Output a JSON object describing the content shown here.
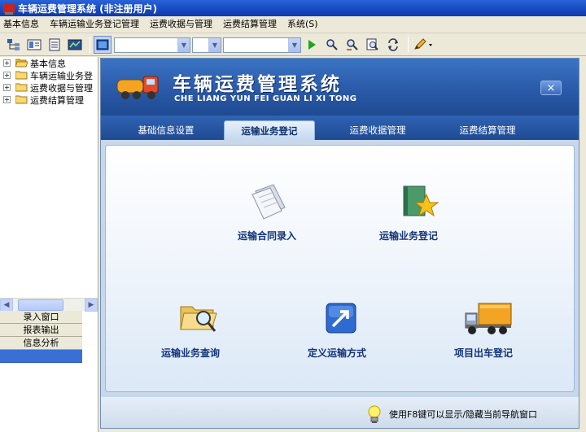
{
  "window": {
    "title": "车辆运费管理系统 (非注册用户)"
  },
  "menubar": {
    "items": [
      {
        "label": "基本信息"
      },
      {
        "label": "车辆运输业务登记管理"
      },
      {
        "label": "运费收据与管理"
      },
      {
        "label": "运费结算管理"
      },
      {
        "label": "系统(S)"
      }
    ]
  },
  "toolbar": {
    "icons": [
      "tree-view-icon",
      "card-icon",
      "document-icon",
      "report-icon",
      "screen-icon",
      "run-icon",
      "find-icon",
      "find-next-icon",
      "preview-icon",
      "refresh-icon",
      "pencil-icon"
    ],
    "combo_values": [
      "",
      "",
      ""
    ]
  },
  "sidebar": {
    "tree": [
      {
        "label": "基本信息",
        "expander": "+"
      },
      {
        "label": "车辆运输业务登",
        "expander": "+"
      },
      {
        "label": "运费收据与管理",
        "expander": "+"
      },
      {
        "label": "运费结算管理",
        "expander": "+"
      }
    ],
    "nav_buttons": [
      {
        "label": "录入窗口"
      },
      {
        "label": "报表输出"
      },
      {
        "label": "信息分析"
      },
      {
        "label": ""
      }
    ]
  },
  "banner": {
    "title": "车辆运费管理系统",
    "subtitle": "CHE LIANG YUN FEI GUAN LI XI TONG",
    "close_label": "×"
  },
  "tabs": [
    {
      "label": "基础信息设置"
    },
    {
      "label": "运输业务登记"
    },
    {
      "label": "运费收据管理"
    },
    {
      "label": "运费结算管理"
    }
  ],
  "features": [
    {
      "label": "运输合同录入",
      "icon": "contract-document-icon"
    },
    {
      "label": "运输业务登记",
      "icon": "star-book-icon"
    },
    {
      "label": "运输业务查询",
      "icon": "folder-search-icon"
    },
    {
      "label": "定义运输方式",
      "icon": "arrow-box-icon"
    },
    {
      "label": "项目出车登记",
      "icon": "truck-icon"
    }
  ],
  "status": {
    "hint": "使用F8键可以显示/隐藏当前导航窗口"
  },
  "colors": {
    "titlebar": "#1748bf",
    "banner": "#2a5aa8",
    "label": "#12337a",
    "tab_active": "#c4d8ef"
  }
}
